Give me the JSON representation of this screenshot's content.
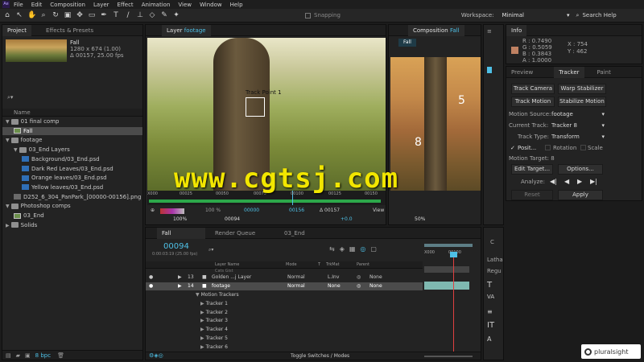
{
  "menu": {
    "logo": "Ae",
    "items": [
      "File",
      "Edit",
      "Composition",
      "Layer",
      "Effect",
      "Animation",
      "View",
      "Window",
      "Help"
    ]
  },
  "toolbar": {
    "snapping": "Snapping",
    "workspace_label": "Workspace:",
    "workspace_value": "Minimal",
    "search_placeholder": "Search Help"
  },
  "project": {
    "tab_project": "Project",
    "tab_effects": "Effects & Presets",
    "thumb_name": "Fall",
    "thumb_line1": "1280 x 674 (1.00)",
    "thumb_line2": "Δ 00157, 25.00 fps",
    "col_name": "Name",
    "rows": [
      {
        "label": "01 final comp",
        "type": "folder",
        "indent": 0,
        "expanded": true
      },
      {
        "label": "Fall",
        "type": "comp",
        "indent": 1,
        "selected": true
      },
      {
        "label": "footage",
        "type": "folder",
        "indent": 0,
        "expanded": true
      },
      {
        "label": "03_End Layers",
        "type": "folder",
        "indent": 1,
        "expanded": true
      },
      {
        "label": "Background/03_End.psd",
        "type": "psd",
        "indent": 2
      },
      {
        "label": "Dark Red Leaves/03_End.psd",
        "type": "psd",
        "indent": 2
      },
      {
        "label": "Orange leaves/03_End.psd",
        "type": "psd",
        "indent": 2
      },
      {
        "label": "Yellow leaves/03_End.psd",
        "type": "psd",
        "indent": 2
      },
      {
        "label": "D252_6_304_PanPark_[00000-00156].png",
        "type": "png",
        "indent": 1
      },
      {
        "label": "Photoshop comps",
        "type": "folder",
        "indent": 0,
        "expanded": true
      },
      {
        "label": "03_End",
        "type": "comp",
        "indent": 1
      },
      {
        "label": "Solids",
        "type": "folder",
        "indent": 0,
        "expanded": false
      }
    ],
    "bpc": "8 bpc"
  },
  "layer_viewer": {
    "tab_label": "Layer",
    "tab_name": "footage",
    "track_point": "Track Point 1",
    "ruler_labels": [
      "X000",
      "00025",
      "00050",
      "00075",
      "00100",
      "00125",
      "00150"
    ],
    "zoom": "100%",
    "frame": "00094",
    "percent": "100 %",
    "in_time": "00000",
    "out_time": "00156",
    "duration": "Δ 00157",
    "offset": "+0.0",
    "view_label": "View"
  },
  "comp_viewer": {
    "tab_label": "Composition",
    "tab_name": "Fall",
    "tag": "Fall",
    "label_5": "5",
    "label_8": "8",
    "zoom": "50%"
  },
  "watermark": "www.cgtsj.com",
  "info": {
    "tab": "Info",
    "r": "R : 0.7490",
    "g": "G : 0.5059",
    "b": "B : 0.3843",
    "a": "A : 1.0000",
    "x": "X : 754",
    "y": "Y : 462"
  },
  "tracker": {
    "tab_preview": "Preview",
    "tab_tracker": "Tracker",
    "tab_paint": "Paint",
    "track_camera": "Track Camera",
    "warp_stabilizer": "Warp Stabilizer",
    "track_motion": "Track Motion",
    "stabilize_motion": "Stabilize Motion",
    "motion_source_label": "Motion Source:",
    "motion_source_value": "footage",
    "current_track_label": "Current Track:",
    "current_track_value": "Tracker 8",
    "track_type_label": "Track Type:",
    "track_type_value": "Transform",
    "position": "Posit...",
    "rotation": "Rotation",
    "scale": "Scale",
    "motion_target": "Motion Target: 8",
    "edit_target": "Edit Target...",
    "options": "Options...",
    "analyze": "Analyze:",
    "reset": "Reset",
    "apply": "Apply"
  },
  "char_panel": {
    "tab": "C",
    "font": "Latha",
    "style": "Regu"
  },
  "timeline": {
    "tab_fall": "Fall",
    "tab_render": "Render Queue",
    "tab_end": "03_End",
    "timecode": "00094",
    "timecode_sub": "0:00:03:19 (25.00 fps)",
    "search_placeholder": "",
    "cols": {
      "layer_name": "Layer Name",
      "mode": "Mode",
      "t": "T",
      "trkmat": "TrkMat",
      "parent": "Parent"
    },
    "partial_row": "Cats Gist",
    "layers": [
      {
        "num": "13",
        "name": "Golden ...j Layer",
        "mode": "Normal",
        "trkmat": "L.Inv",
        "parent": "None"
      },
      {
        "num": "14",
        "name": "footage",
        "mode": "Normal",
        "trkmat": "None",
        "parent": "None"
      }
    ],
    "motion_trackers": "Motion Trackers",
    "trackers": [
      "Tracker 1",
      "Tracker 2",
      "Tracker 3",
      "Tracker 4",
      "Tracker 5",
      "Tracker 6"
    ],
    "ruler": [
      "X000",
      "00100"
    ],
    "toggle": "Toggle Switches / Modes"
  },
  "brand": "pluralsight",
  "colors": {
    "accent": "#4ec0e6",
    "watermark": "#f2e600",
    "bg": "#232323"
  }
}
